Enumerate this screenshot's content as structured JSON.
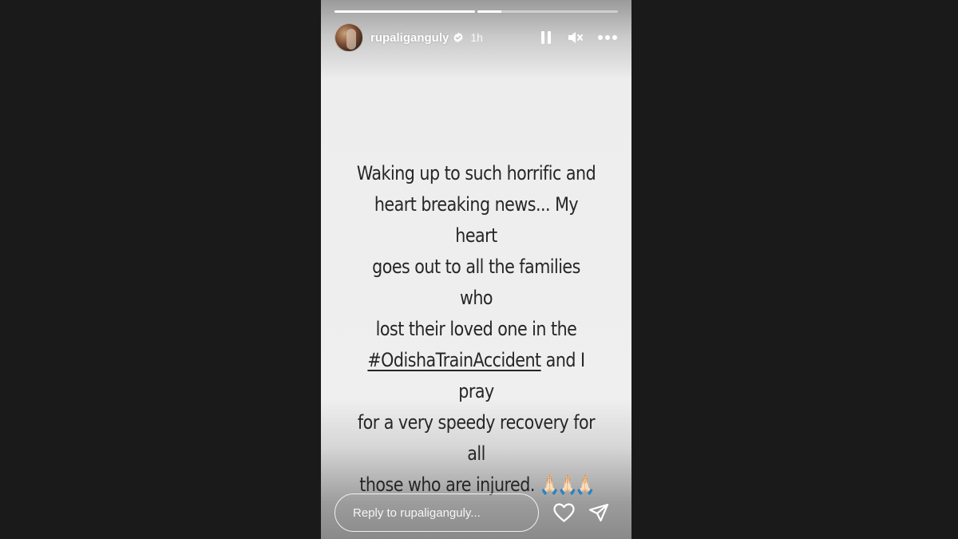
{
  "story": {
    "progress": [
      1.0,
      0.17,
      0.0
    ],
    "user": {
      "username": "rupaliganguly",
      "verified": true,
      "time": "1h"
    },
    "controls": {
      "pause_icon": "pause-icon",
      "mute_icon": "muted-speaker-icon",
      "more_icon": "more-options-icon"
    },
    "message": {
      "line1": "Waking up to such horrific and",
      "line2": "heart breaking news... My heart",
      "line3": "goes out to all the families who",
      "line4": "lost their loved one in the",
      "hashtag": "#OdishaTrainAccident",
      "line5_rest": " and I pray",
      "line6": "for a very speedy recovery for all",
      "line7": "those who are injured. ",
      "emoji": "🙏🏻🙏🏻🙏🏻"
    },
    "reply": {
      "placeholder": "Reply to rupaliganguly..."
    },
    "footer": {
      "like_icon": "heart-icon",
      "send_icon": "send-icon"
    }
  },
  "colors": {
    "background": "#1a1a1a",
    "text": "#262626",
    "ui": "#ffffff"
  }
}
